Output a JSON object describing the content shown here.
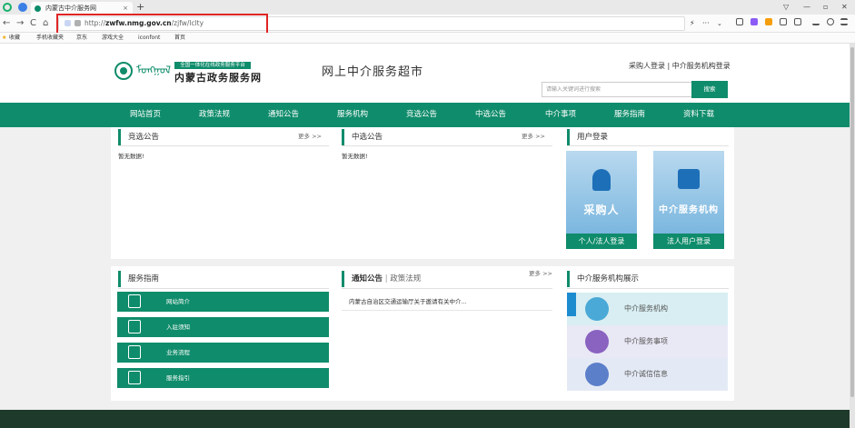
{
  "browser": {
    "tab_title": "内蒙古中介服务网",
    "tab_close": "×",
    "new_tab": "+",
    "url_prefix": "http://",
    "url_domain": "zwfw.nmg.gov.cn",
    "url_path": "/zjfw/lclty",
    "nav_back": "←",
    "nav_forward": "→",
    "nav_reload": "C",
    "nav_home": "⌂",
    "toolbar_more": "···",
    "bookmarks": [
      "收藏",
      "手机收藏夹",
      "京东",
      "游戏大全",
      "iconfont",
      "首页"
    ]
  },
  "header": {
    "logo_mongol": "ᠮᠣᠩᠭᠣᠯ",
    "logo_strip": "全国一体化在线政务服务平台",
    "logo_title": "内蒙古政务服务网",
    "site_title": "网上中介服务超市",
    "login_links": "采购人登录 | 中介服务机构登录",
    "search_placeholder": "请输入关键词进行搜索",
    "search_button": "搜索"
  },
  "nav": [
    "网站首页",
    "政策法规",
    "通知公告",
    "服务机构",
    "竞选公告",
    "中选公告",
    "中介事项",
    "服务指南",
    "资料下载"
  ],
  "bidding": {
    "title": "竞选公告",
    "more": "更多 >>",
    "empty": "暂无数据!"
  },
  "selected": {
    "title": "中选公告",
    "more": "更多 >>",
    "empty": "暂无数据!"
  },
  "user_login": {
    "title": "用户登录",
    "buyer_big": "采购人",
    "buyer_label": "个人/法人登录",
    "agency_big": "中介服务机构",
    "agency_label": "法人用户登录"
  },
  "guide": {
    "title": "服务指南",
    "items": [
      "网站简介",
      "入驻须知",
      "业务流程",
      "服务指引"
    ]
  },
  "notices": {
    "title_active": "通知公告",
    "title_sep": " | ",
    "title_inactive": "政策法规",
    "more": "更多 >>",
    "items": [
      "内蒙古自治区交通运输厅关于邀请有关中介..."
    ]
  },
  "orgs": {
    "title": "中介服务机构展示",
    "items": [
      "中介服务机构",
      "中介服务事项",
      "中介诚信信息"
    ],
    "colors": [
      "#d8eef2",
      "#e9e8f5",
      "#e4eaf5"
    ],
    "icon_colors": [
      "#4aa9d6",
      "#8a62c0",
      "#5b7fc9"
    ]
  },
  "colors": {
    "brand_green": "#0f8c6b",
    "footer": "#1e3a2a"
  }
}
